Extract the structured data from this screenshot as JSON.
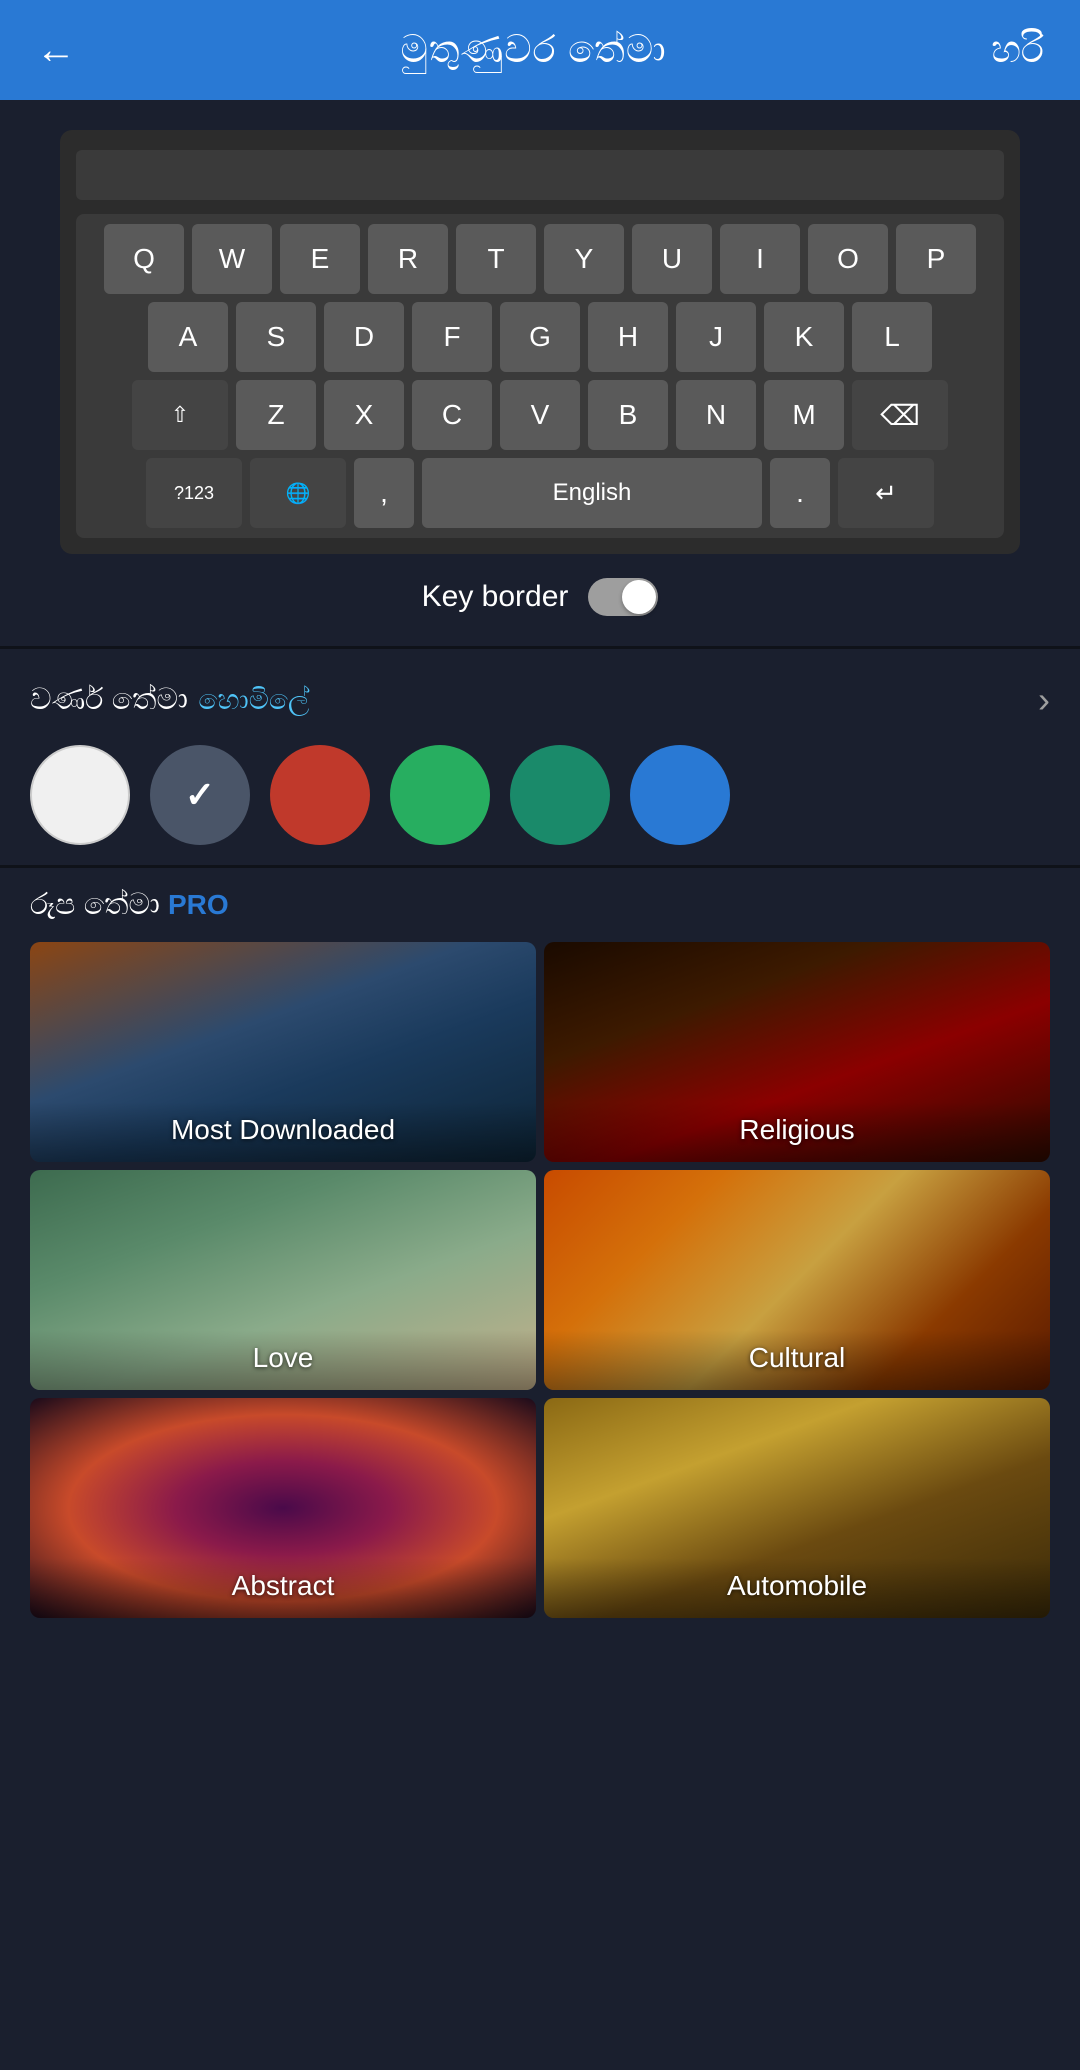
{
  "header": {
    "back_icon": "←",
    "title": "මුතුණුවර තේමා",
    "ok_label": "හරි"
  },
  "keyboard": {
    "rows": [
      [
        "Q",
        "W",
        "E",
        "R",
        "T",
        "Y",
        "U",
        "I",
        "O",
        "P"
      ],
      [
        "A",
        "S",
        "D",
        "F",
        "G",
        "H",
        "J",
        "K",
        "L"
      ],
      [
        "⇧",
        "Z",
        "X",
        "C",
        "V",
        "B",
        "N",
        "M",
        "⌫"
      ],
      [
        "?123",
        "🌐",
        ",",
        "English",
        ".",
        "↵"
      ]
    ],
    "key_border_label": "Key border"
  },
  "color_theme": {
    "title": "වර්ණ තේමා",
    "subtitle": "හොමිලේ",
    "swatches": [
      {
        "color": "#f0f0f0",
        "selected": false
      },
      {
        "color": "#4a5568",
        "selected": true
      },
      {
        "color": "#c0392b",
        "selected": false
      },
      {
        "color": "#27ae60",
        "selected": false
      },
      {
        "color": "#1a8a6a",
        "selected": false
      },
      {
        "color": "#2979d4",
        "selected": false
      }
    ]
  },
  "image_theme": {
    "title": "රූප තේමා",
    "pro_label": "PRO",
    "tiles": [
      {
        "id": "most-downloaded",
        "label": "Most Downloaded",
        "bg_class": "tile-most-downloaded"
      },
      {
        "id": "religious",
        "label": "Religious",
        "bg_class": "tile-religious"
      },
      {
        "id": "love",
        "label": "Love",
        "bg_class": "tile-love"
      },
      {
        "id": "cultural",
        "label": "Cultural",
        "bg_class": "tile-cultural"
      },
      {
        "id": "abstract",
        "label": "Abstract",
        "bg_class": "tile-abstract"
      },
      {
        "id": "automobile",
        "label": "Automobile",
        "bg_class": "tile-automobile"
      }
    ]
  }
}
